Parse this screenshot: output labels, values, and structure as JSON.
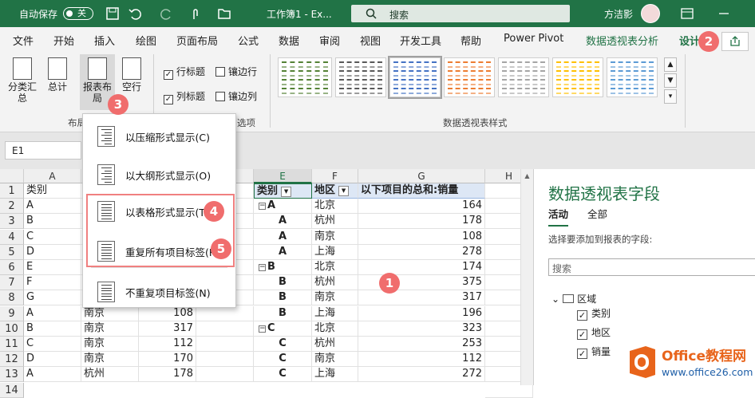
{
  "titlebar": {
    "autosave": "自动保存",
    "toggle": "关",
    "doc": "工作簿1 - Ex...",
    "search": "搜索",
    "user": "方洁影"
  },
  "tabs": [
    "文件",
    "开始",
    "插入",
    "绘图",
    "页面布局",
    "公式",
    "数据",
    "审阅",
    "视图",
    "开发工具",
    "帮助",
    "Power Pivot",
    "数据透视表分析",
    "设计"
  ],
  "ribbon": {
    "subtotal": "分类汇总",
    "grand_total": "总计",
    "report_layout": "报表布局",
    "blank_rows": "空行",
    "row_headers": "行标题",
    "banded_rows": "镶边行",
    "col_headers": "列标题",
    "banded_cols": "镶边列",
    "group_layout": "布局",
    "group_options": "选项",
    "group_styles": "数据透视表样式"
  },
  "style_colors": [
    "#548235",
    "#595959",
    "#4472c4",
    "#ed7d31",
    "#a5a5a5",
    "#ffc000",
    "#5b9bd5"
  ],
  "namebox": "E1",
  "columns": [
    "A",
    "B",
    "C",
    "D",
    "E",
    "F",
    "G",
    "H"
  ],
  "rows": [
    "1",
    "2",
    "3",
    "4",
    "5",
    "6",
    "7",
    "8",
    "9",
    "10",
    "11",
    "12",
    "13",
    "14"
  ],
  "source": [
    [
      "类别",
      "",
      "",
      ""
    ],
    [
      "A",
      "",
      "",
      ""
    ],
    [
      "B",
      "",
      "",
      ""
    ],
    [
      "C",
      "",
      "",
      ""
    ],
    [
      "D",
      "",
      "",
      ""
    ],
    [
      "E",
      "",
      "",
      ""
    ],
    [
      "F",
      "",
      "",
      ""
    ],
    [
      "G",
      "",
      "",
      ""
    ],
    [
      "A",
      "南京",
      "108",
      ""
    ],
    [
      "B",
      "南京",
      "317",
      ""
    ],
    [
      "C",
      "南京",
      "112",
      ""
    ],
    [
      "D",
      "南京",
      "170",
      ""
    ],
    [
      "A",
      "杭州",
      "178",
      ""
    ]
  ],
  "pivot": {
    "h1": "类别",
    "h2": "地区",
    "h3": "以下项目的总和:销量",
    "rows": [
      [
        "A",
        "北京",
        "164"
      ],
      [
        "A",
        "杭州",
        "178"
      ],
      [
        "A",
        "南京",
        "108"
      ],
      [
        "A",
        "上海",
        "278"
      ],
      [
        "B",
        "北京",
        "174"
      ],
      [
        "B",
        "杭州",
        "375"
      ],
      [
        "B",
        "南京",
        "317"
      ],
      [
        "B",
        "上海",
        "196"
      ],
      [
        "C",
        "北京",
        "323"
      ],
      [
        "C",
        "杭州",
        "253"
      ],
      [
        "C",
        "南京",
        "112"
      ],
      [
        "C",
        "上海",
        "272"
      ]
    ]
  },
  "menu": [
    {
      "label": "以压缩形式显示(C)"
    },
    {
      "label": "以大纲形式显示(O)"
    },
    {
      "label": "以表格形式显示(T)"
    },
    {
      "label": "重复所有项目标签(R)"
    },
    {
      "label": "不重复项目标签(N)"
    }
  ],
  "badges": [
    "1",
    "2",
    "3",
    "4",
    "5"
  ],
  "panel": {
    "title": "数据透视表字段",
    "tab_active": "活动",
    "tab_all": "全部",
    "desc": "选择要添加到报表的字段:",
    "search": "搜索",
    "table": "区域",
    "fields": [
      "类别",
      "地区",
      "销量"
    ]
  },
  "watermark": {
    "brand": "Office教程网",
    "url": "www.office26.com"
  }
}
